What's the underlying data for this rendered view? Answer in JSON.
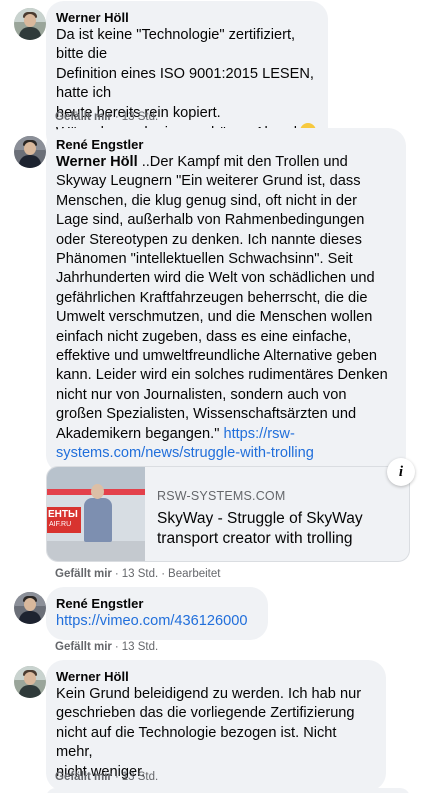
{
  "comments": [
    {
      "author": "Werner Höll",
      "text": "Da ist keine \"Technologie\" zertifiziert, bitte die\nDefinition eines ISO 9001:2015 LESEN, hatte ich\nheute bereits rein kopiert.\nWünsche noch einen schönen Abend",
      "emoji": "smiling-face-emoji",
      "like_label": "Gefällt mir",
      "time": "13 Std."
    },
    {
      "author": "René Engstler",
      "mention": "Werner Höll",
      "text": " ..Der Kampf mit den Trollen und\nSkyway Leugnern \"Ein weiterer Grund ist, dass\nMenschen, die klug genug sind, oft nicht in der\nLage sind, außerhalb von Rahmenbedingungen\noder Stereotypen zu denken. Ich nannte dieses\nPhänomen \"intellektuellen Schwachsinn\". Seit\nJahrhunderten wird die Welt von schädlichen und\ngefährlichen Kraftfahrzeugen beherrscht, die die\nUmwelt verschmutzen, und die Menschen wollen\neinfach nicht zugeben, dass es eine einfache,\neffektive und umweltfreundliche Alternative geben\nkann. Leider wird ein solches rudimentäres Denken\nnicht nur von Journalisten, sondern auch von\ngroßen Spezialisten, Wissenschaftsärzten und\nAkademikern begangen.\" ",
      "link": "https://rsw-\nsystems.com/news/struggle-with-trolling",
      "preview": {
        "domain": "RSW-SYSTEMS.COM",
        "title": "SkyWay - Struggle of SkyWay transport creator with trolling",
        "thumb_label": "ЕНТЫ",
        "thumb_site": "AIF.RU"
      },
      "like_label": "Gefällt mir",
      "time": "13 Std.",
      "edited": "Bearbeitet"
    },
    {
      "author": "René Engstler",
      "link": "https://vimeo.com/436126000",
      "like_label": "Gefällt mir",
      "time": "13 Std."
    },
    {
      "author": "Werner Höll",
      "text": "Kein Grund beleidigend zu werden. Ich hab nur\ngeschrieben das die vorliegende Zertifizierung\nnicht auf die Technologie bezogen ist. Nicht mehr,\nnicht weniger.",
      "like_label": "Gefällt mir",
      "time": "13 Std."
    }
  ],
  "separator": "·",
  "icons": {
    "info": "info-icon"
  },
  "info_glyph": "i",
  "colors": {
    "bubble": "#f0f2f5",
    "link": "#216fdb",
    "meta": "#65676b"
  }
}
